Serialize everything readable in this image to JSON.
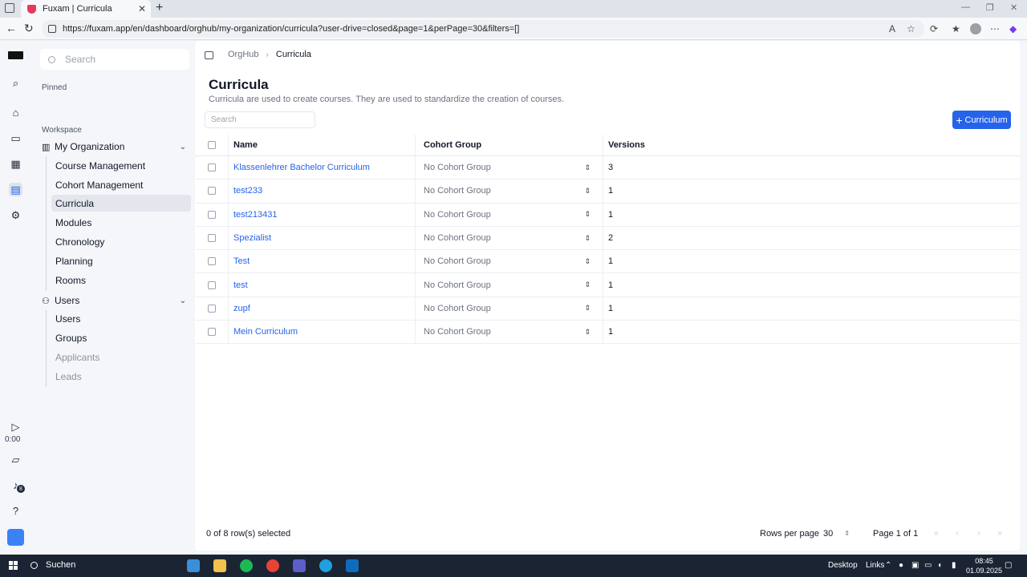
{
  "browser": {
    "tab_title": "Fuxam | Curricula",
    "url": "https://fuxam.app/en/dashboard/orghub/my-organization/curricula?user-drive=closed&page=1&perPage=30&filters=[]"
  },
  "rail": {
    "time": "0:00",
    "notifications": "8"
  },
  "sidebar": {
    "search_placeholder": "Search",
    "pinned_label": "Pinned",
    "workspace_label": "Workspace",
    "org_group": "My Organization",
    "org_items": [
      "Course Management",
      "Cohort Management",
      "Curricula",
      "Modules",
      "Chronology",
      "Planning",
      "Rooms"
    ],
    "users_group": "Users",
    "user_items": [
      "Users",
      "Groups",
      "Applicants",
      "Leads"
    ]
  },
  "breadcrumb": {
    "root": "OrgHub",
    "current": "Curricula"
  },
  "page": {
    "title": "Curricula",
    "description": "Curricula are used to create courses. They are used to standardize the creation of courses.",
    "search_placeholder": "Search",
    "add_button": "Curriculum"
  },
  "table": {
    "columns": [
      "Name",
      "Cohort Group",
      "Versions"
    ],
    "rows": [
      {
        "name": "Klassenlehrer Bachelor Curriculum",
        "cohort": "No Cohort Group",
        "versions": "3"
      },
      {
        "name": "test233",
        "cohort": "No Cohort Group",
        "versions": "1"
      },
      {
        "name": "test213431",
        "cohort": "No Cohort Group",
        "versions": "1"
      },
      {
        "name": "Spezialist",
        "cohort": "No Cohort Group",
        "versions": "2"
      },
      {
        "name": "Test",
        "cohort": "No Cohort Group",
        "versions": "1"
      },
      {
        "name": "test",
        "cohort": "No Cohort Group",
        "versions": "1"
      },
      {
        "name": "zupf",
        "cohort": "No Cohort Group",
        "versions": "1"
      },
      {
        "name": "Mein Curriculum",
        "cohort": "No Cohort Group",
        "versions": "1"
      }
    ]
  },
  "footer": {
    "selected": "0 of 8 row(s) selected",
    "rows_per_page_label": "Rows per page",
    "rows_per_page": "30",
    "page_info": "Page 1 of 1"
  },
  "taskbar": {
    "search": "Suchen",
    "desktop": "Desktop",
    "links": "Links",
    "time": "08:45",
    "date": "01.09.2025"
  },
  "colors": {
    "accent": "#2563eb",
    "sidebar_bg": "#f4f6fa",
    "taskbar_bg": "#1b2433"
  }
}
